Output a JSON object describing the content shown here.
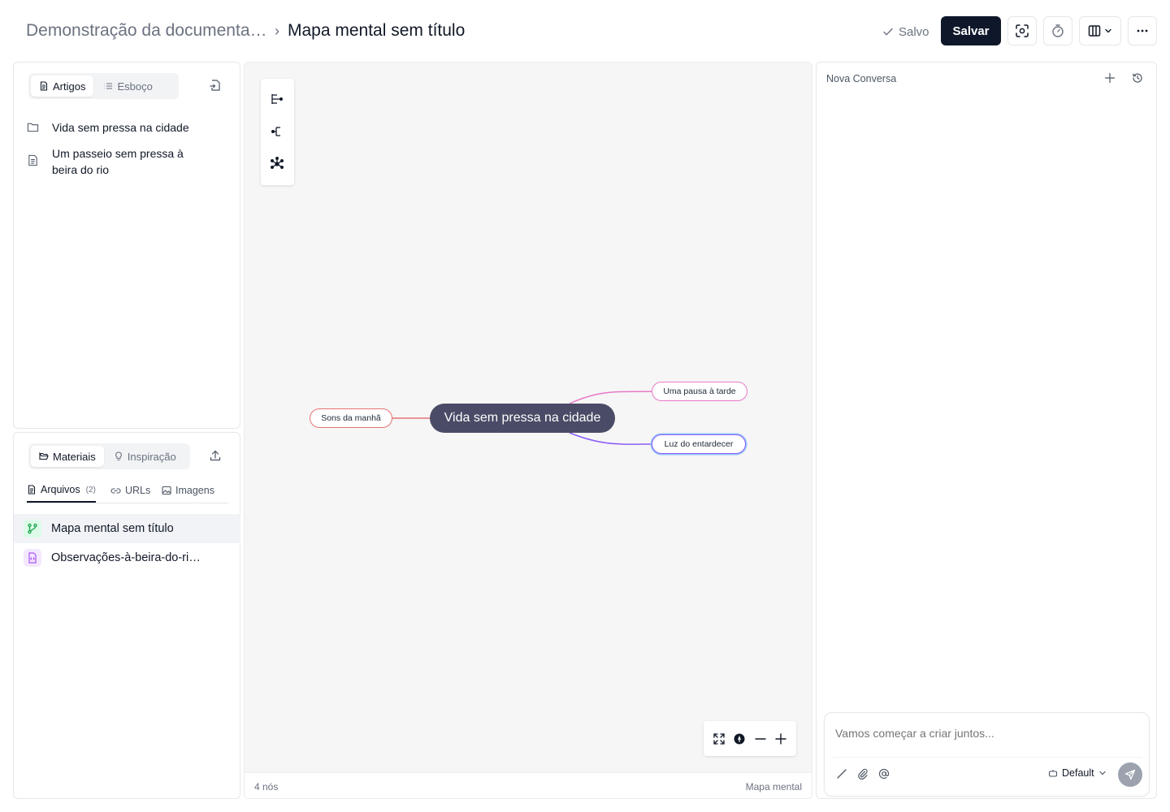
{
  "header": {
    "breadcrumb_parent": "Demonstração da documenta…",
    "breadcrumb_separator": "›",
    "breadcrumb_current": "Mapa mental sem título",
    "saved_status": "Salvo",
    "save_label": "Salvar"
  },
  "left_top": {
    "tabs": [
      {
        "label": "Artigos",
        "active": true,
        "icon": "file-text-icon"
      },
      {
        "label": "Esboço",
        "active": false,
        "icon": "list-icon"
      }
    ],
    "action_icon": "file-import-icon",
    "items": [
      {
        "label": "Vida sem pressa na cidade",
        "icon": "folder-icon"
      },
      {
        "label": "Um passeio sem pressa à beira do rio",
        "icon": "file-text-icon"
      }
    ]
  },
  "left_bottom": {
    "tabs": [
      {
        "label": "Materiais",
        "active": true,
        "icon": "folder-open-icon"
      },
      {
        "label": "Inspiração",
        "active": false,
        "icon": "lightbulb-icon"
      }
    ],
    "action_icon": "upload-icon",
    "subtabs": [
      {
        "label": "Arquivos",
        "count": "(2)",
        "active": true,
        "icon": "file-text-icon"
      },
      {
        "label": "URLs",
        "count": "",
        "active": false,
        "icon": "link-icon"
      },
      {
        "label": "Imagens",
        "count": "",
        "active": false,
        "icon": "image-icon"
      }
    ],
    "files": [
      {
        "label": "Mapa mental sem título",
        "icon": "git-branch-icon",
        "active": true,
        "color": "#16a34a",
        "bg": "#dcfce7"
      },
      {
        "label": "Observações-à-beira-do-ri…",
        "icon": "code-file-icon",
        "active": false,
        "color": "#a855f7",
        "bg": "#f3e8ff"
      }
    ]
  },
  "mindmap": {
    "root": "Vida sem pressa na cidade",
    "branches": [
      {
        "label": "Sons da manhã",
        "color": "#e57373"
      },
      {
        "label": "Uma pausa à tarde",
        "color": "#e879c6"
      },
      {
        "label": "Luz do entardecer",
        "color": "#8b5cf6",
        "selected": true
      }
    ],
    "node_count": "4 nós",
    "mode_label": "Mapa mental"
  },
  "chat": {
    "title": "Nova Conversa",
    "placeholder": "Vamos começar a criar juntos...",
    "model": "Default"
  },
  "colors": {
    "primary": "#0f172a",
    "root_node": "#4a4b66",
    "selected_outline": "#3b82f6"
  }
}
